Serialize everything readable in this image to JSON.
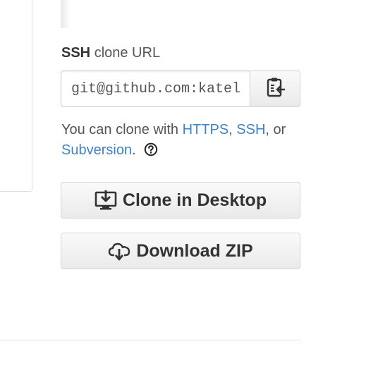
{
  "clone_box": {
    "protocol_label": "SSH",
    "label_suffix": "clone URL",
    "url_value": "git@github.com:katelynsills/ca",
    "copy_icon": "clipboard-icon"
  },
  "help": {
    "prefix": "You can clone with",
    "https_link": "HTTPS",
    "separator": ",",
    "ssh_link": "SSH",
    "or_text": ", or",
    "subversion_link": "Subversion",
    "period": ".",
    "help_icon": "question-circle-icon"
  },
  "buttons": {
    "clone_desktop_label": "Clone in Desktop",
    "clone_desktop_icon": "desktop-download-icon",
    "download_zip_label": "Download ZIP",
    "download_zip_icon": "cloud-download-icon"
  },
  "colors": {
    "link": "#4183c4",
    "text": "#333333",
    "border": "#d5d5d5"
  }
}
